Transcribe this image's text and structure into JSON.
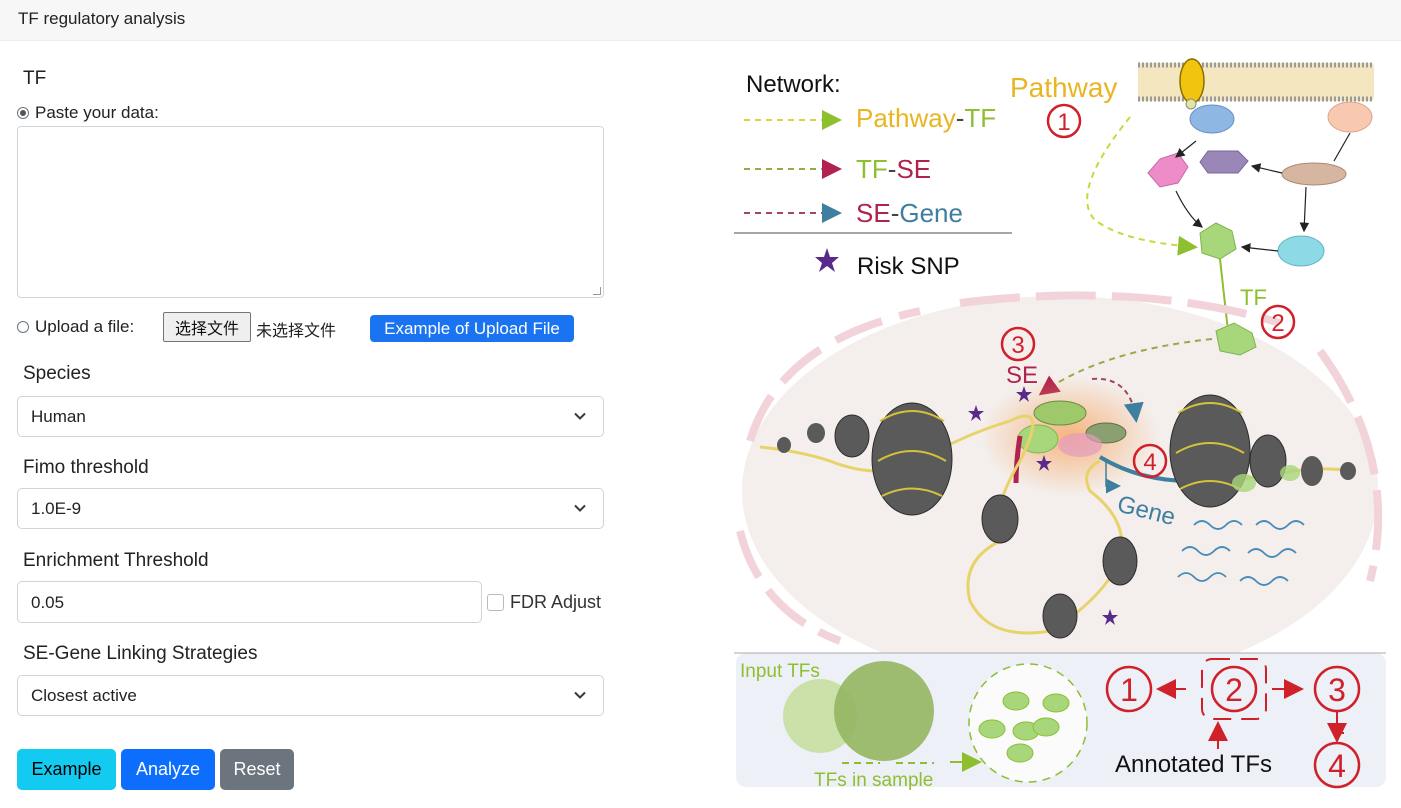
{
  "header": {
    "title": "TF regulatory analysis"
  },
  "form": {
    "tf_label": "TF",
    "paste_label": "Paste your data:",
    "paste_value": "",
    "upload_label": "Upload a file:",
    "choose_file_label": "选择文件",
    "no_file_label": "未选择文件",
    "example_upload_label": "Example of Upload File",
    "species_label": "Species",
    "species_value": "Human",
    "fimo_label": "Fimo threshold",
    "fimo_value": "1.0E-9",
    "enrichment_label": "Enrichment Threshold",
    "enrichment_value": "0.05",
    "fdr_label": "FDR Adjust",
    "linking_label": "SE-Gene Linking Strategies",
    "linking_value": "Closest active",
    "buttons": {
      "example": "Example",
      "analyze": "Analyze",
      "reset": "Reset"
    }
  },
  "figure": {
    "network_title": "Network:",
    "legend": {
      "pathway_tf": {
        "a": "Pathway",
        "dash": "-",
        "b": "TF"
      },
      "tf_se": {
        "a": "TF",
        "dash": "-",
        "b": "SE"
      },
      "se_gene": {
        "a": "SE",
        "dash": "-",
        "b": "Gene"
      },
      "risk_snp": "Risk SNP"
    },
    "pathway_label": "Pathway",
    "tf_label": "TF",
    "se_label": "SE",
    "gene_label": "Gene",
    "input_tfs": "Input TFs",
    "tfs_in_sample": "TFs in sample",
    "annotated_tfs": "Annotated TFs",
    "steps": [
      "1",
      "2",
      "3",
      "4"
    ],
    "colors": {
      "pathway": "#e8b523",
      "tf": "#8dbf2f",
      "se": "#b0234e",
      "gene": "#3e7fa0",
      "step": "#d0202a",
      "snp": "#5a2a8a"
    }
  }
}
